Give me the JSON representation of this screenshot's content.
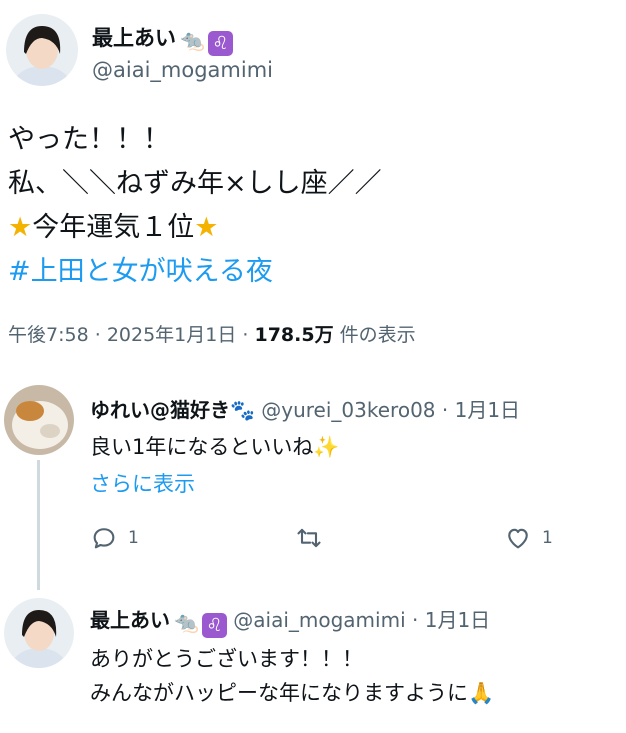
{
  "main_tweet": {
    "author_name": "最上あい",
    "rat_emoji": "🐀",
    "leo_badge": "♌",
    "handle": "@aiai_mogamimi",
    "lines": [
      "やった！！！",
      "私、＼＼ねずみ年×しし座／／",
      "今年運気１位"
    ],
    "star_emoji": "★",
    "hashtag": "#上田と女が吠える夜",
    "time": "午後7:58",
    "date": "2025年1月1日",
    "views_count": "178.5万",
    "views_label": "件の表示",
    "separator": "·"
  },
  "reply_1": {
    "author_name": "ゆれい@猫好き",
    "paw_emoji": "🐾",
    "handle": "@yurei_03kero08",
    "date": "1月1日",
    "text": "良い1年になるといいね",
    "sparkle": "✨",
    "show_more": "さらに表示",
    "reply_count": "1",
    "like_count": "1"
  },
  "reply_2": {
    "author_name": "最上あい",
    "rat_emoji": "🐀",
    "leo_badge": "♌",
    "handle": "@aiai_mogamimi",
    "date": "1月1日",
    "lines": [
      "ありがとうございます！！！",
      "みんながハッピーな年になりますように"
    ],
    "pray_emoji": "🙏"
  },
  "colors": {
    "link": "#1d9bf0",
    "secondary": "#536471",
    "leo_badge_bg": "#9b59d0"
  }
}
